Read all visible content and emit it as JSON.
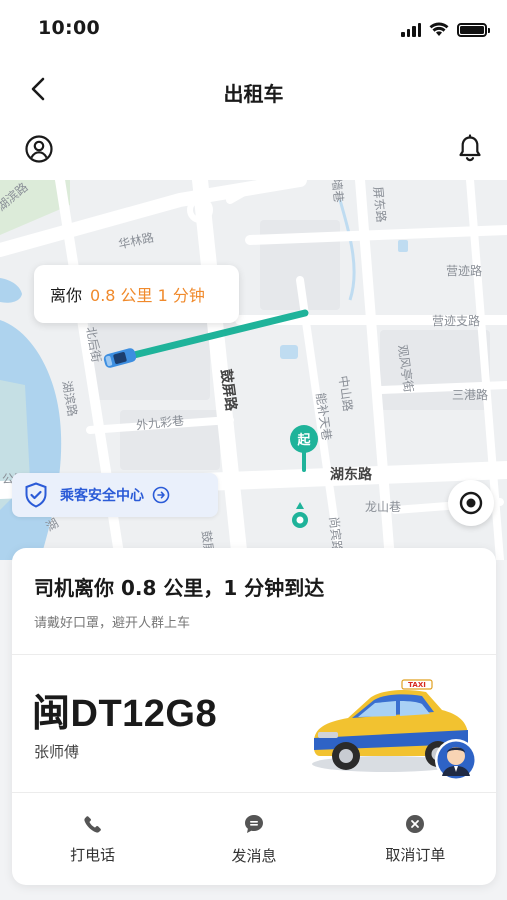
{
  "status_bar": {
    "time": "10:00"
  },
  "nav": {
    "title": "出租车"
  },
  "map": {
    "distance_prefix": "离你",
    "distance_value": "0.8 公里 1 分钟",
    "pickup_marker": "起",
    "safety_center": "乘客安全中心",
    "roads": {
      "r1": "华林路",
      "r2": "北后街",
      "r3": "湖滨路",
      "r4": "外九彩巷",
      "r5": "鼓屏路",
      "r6": "能补天巷",
      "r7": "中山路",
      "r8": "湖东路",
      "r9": "龙山巷",
      "r10": "尚宾路",
      "r11": "营迹路",
      "r12": "营迹支路",
      "r13": "观风亭街",
      "r14": "三港路",
      "r15": "屏东路",
      "r16": "湖滨路",
      "r17": "公园",
      "r18": "墙巷",
      "r19": "鼓屏",
      "r20": "湖"
    }
  },
  "trip": {
    "eta_title": "司机离你 0.8 公里，1 分钟到达",
    "eta_tip": "请戴好口罩，避开人群上车",
    "plate": "闽DT12G8",
    "driver": "张师傅",
    "taxi_sign": "TAXI"
  },
  "actions": {
    "call": "打电话",
    "message": "发消息",
    "cancel": "取消订单"
  },
  "colors": {
    "route": "#1fb39a",
    "accent": "#f08a2c",
    "safety": "#2b5bd7"
  }
}
